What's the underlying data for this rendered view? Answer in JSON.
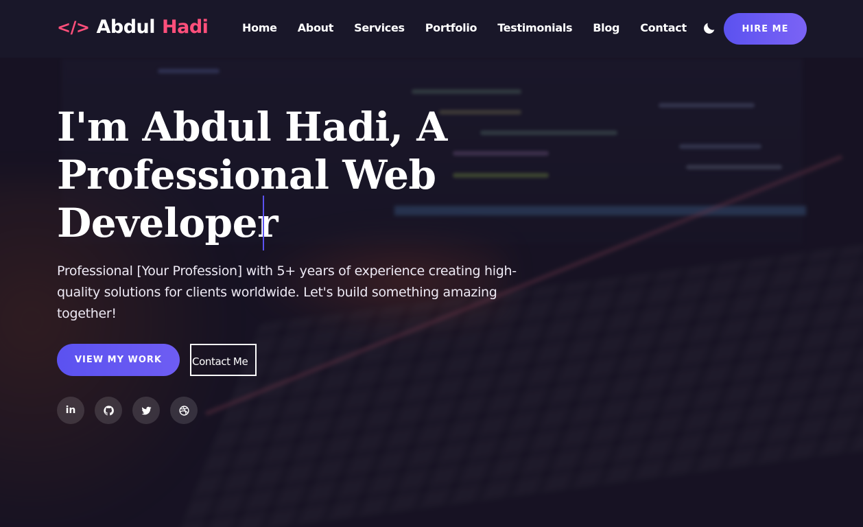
{
  "brand": {
    "icon": "</>",
    "first": "Abdul",
    "last": "Hadi",
    "accent_color": "#ff4f7b"
  },
  "nav": {
    "items": [
      "Home",
      "About",
      "Services",
      "Portfolio",
      "Testimonials",
      "Blog",
      "Contact"
    ],
    "theme_icon": "moon-icon",
    "hire_label": "HIRE ME"
  },
  "hero": {
    "title": "I'm Abdul Hadi, A Professional Web Developer",
    "subtitle": "Professional [Your Profession] with 5+ years of experience creating high-quality solutions for clients worldwide. Let's build something amazing together!",
    "primary_cta": "VIEW MY WORK",
    "secondary_cta": "Contact Me"
  },
  "socials": [
    {
      "icon": "linkedin-icon",
      "text": "in"
    },
    {
      "icon": "github-icon"
    },
    {
      "icon": "twitter-icon"
    },
    {
      "icon": "dribbble-icon"
    }
  ],
  "colors": {
    "primary": "#5b52f0",
    "navbar_bg": "#1a182a"
  }
}
